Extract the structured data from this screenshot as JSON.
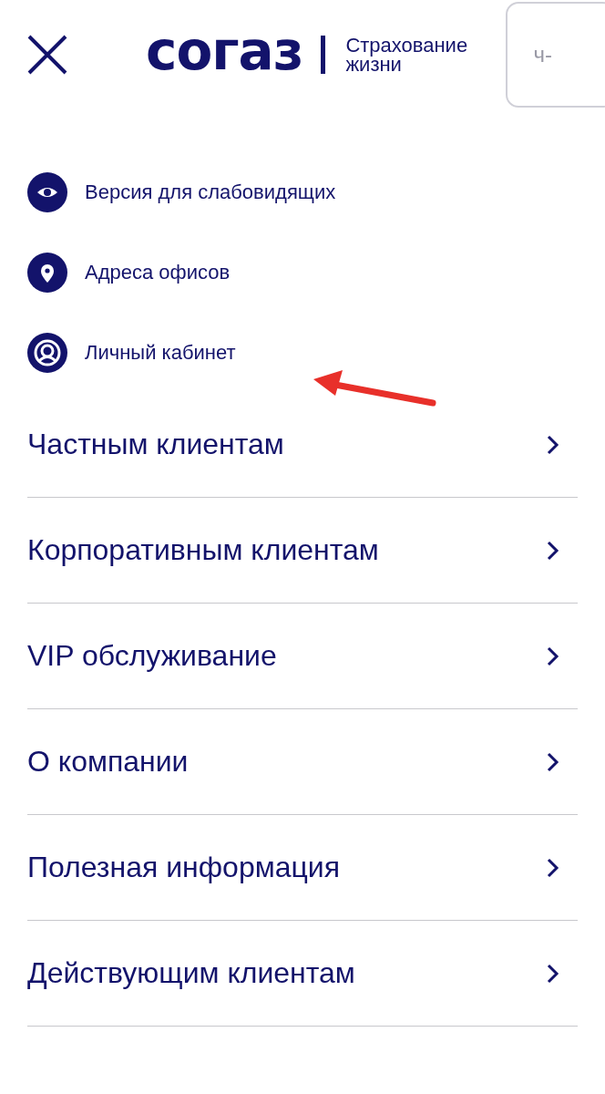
{
  "header": {
    "logo": "согаз",
    "tagline_line1": "Страхование",
    "tagline_line2": "жизни",
    "cut_box_text": "ч-"
  },
  "quick_links": [
    {
      "kind": "eye",
      "label": "Версия для слабовидящих"
    },
    {
      "kind": "pin",
      "label": "Адреса офисов"
    },
    {
      "kind": "user",
      "label": "Личный кабинет"
    }
  ],
  "menu": [
    {
      "label": "Частным клиентам"
    },
    {
      "label": "Корпоративным клиентам"
    },
    {
      "label": "VIP обслуживание"
    },
    {
      "label": "О компании"
    },
    {
      "label": "Полезная информация"
    },
    {
      "label": "Действующим клиентам"
    }
  ]
}
